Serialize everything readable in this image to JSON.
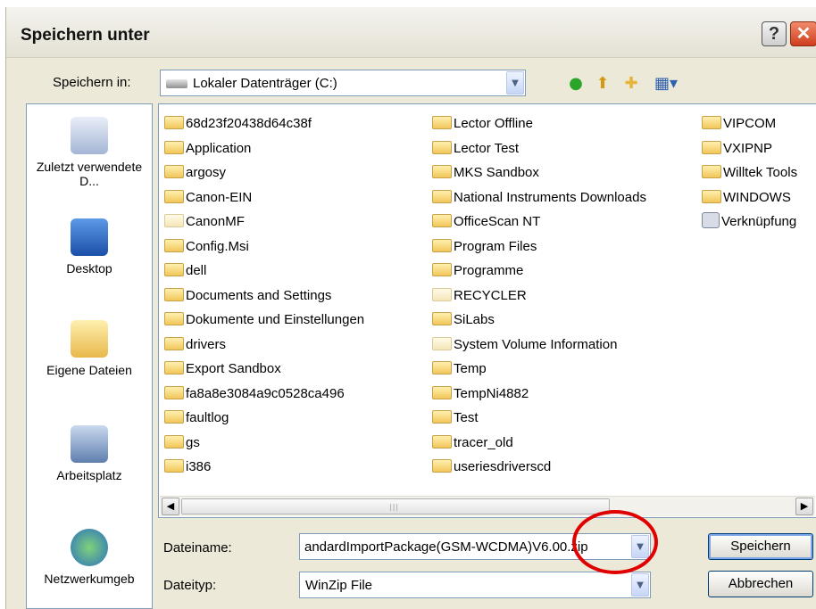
{
  "window": {
    "title": "Speichern unter",
    "help_glyph": "?",
    "close_glyph": "✕"
  },
  "location": {
    "label": "Speichern in:",
    "value": "Lokaler Datenträger (C:)"
  },
  "toolbar": {
    "back_icon": "back-icon",
    "up_icon": "up-folder-icon",
    "new_folder_icon": "new-folder-icon",
    "view_icon": "view-menu-icon"
  },
  "places": [
    {
      "label": "Zuletzt verwendete D...",
      "icon": "recent-documents-icon"
    },
    {
      "label": "Desktop",
      "icon": "desktop-icon"
    },
    {
      "label": "Eigene Dateien",
      "icon": "my-documents-icon"
    },
    {
      "label": "Arbeitsplatz",
      "icon": "my-computer-icon"
    },
    {
      "label": "Netzwerkumgeb",
      "icon": "network-icon"
    }
  ],
  "files": {
    "col1": [
      "68d23f20438d64c38f",
      "Application",
      "argosy",
      "Canon-EIN",
      "CanonMF",
      "Config.Msi",
      "dell",
      "Documents and Settings",
      "Dokumente und Einstellungen",
      "drivers",
      "Export Sandbox",
      "fa8a8e3084a9c0528ca496",
      "faultlog",
      "gs",
      "i386"
    ],
    "col2": [
      "Lector Offline",
      "Lector Test",
      "MKS Sandbox",
      "National Instruments Downloads",
      "OfficeScan NT",
      "Program Files",
      "Programme",
      "RECYCLER",
      "SiLabs",
      "System Volume Information",
      "Temp",
      "TempNi4882",
      "Test",
      "tracer_old",
      "useriesdriverscd"
    ],
    "col3": [
      "VIPCOM",
      "VXIPNP",
      "Willtek Tools",
      "WINDOWS",
      "Verknüpfung"
    ]
  },
  "filename": {
    "label": "Dateiname:",
    "value": "andardImportPackage(GSM-WCDMA)V6.00.zip"
  },
  "filetype": {
    "label": "Dateityp:",
    "value": "WinZip File"
  },
  "buttons": {
    "save": "Speichern",
    "cancel": "Abbrechen"
  },
  "colors": {
    "highlight_circle": "#e10000",
    "folder": "#f2c659"
  }
}
